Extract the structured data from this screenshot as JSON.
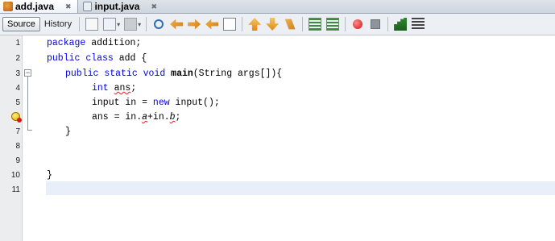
{
  "tabs": [
    {
      "label": "add.java",
      "close": "✖"
    },
    {
      "label": "input.java",
      "close": "✖"
    }
  ],
  "toolbar": {
    "source_label": "Source",
    "history_label": "History"
  },
  "editor": {
    "line_numbers": [
      "1",
      "2",
      "3",
      "4",
      "5",
      "6",
      "7",
      "8",
      "9",
      "10",
      "11"
    ],
    "lines": {
      "l1_kw": "package",
      "l1_rest": " addition;",
      "l2_kw1": "public",
      "l2_kw2": "class",
      "l2_rest": " add {",
      "l3_kw1": "public",
      "l3_kw2": "static",
      "l3_kw3": "void",
      "l3_name": "main",
      "l3_rest": "(String args[]){",
      "l4_kw": "int",
      "l4_var": "ans",
      "l4_rest": ";",
      "l5_pre": "input in = ",
      "l5_kw": "new",
      "l5_rest": " input();",
      "l6_pre": "ans = in.",
      "l6_a": "a",
      "l6_mid": "+in.",
      "l6_b": "b",
      "l6_end": ";",
      "l7": "}",
      "l10": "}"
    },
    "fold_glyph": "−"
  },
  "icons": [
    "history-icon",
    "back-icon",
    "forward-icon",
    "search-icon",
    "find-prev-icon",
    "find-next-icon",
    "toggle-highlight-icon",
    "toggle-bookmark-icon",
    "prev-bookmark-icon",
    "next-bookmark-icon",
    "shift-left-icon",
    "shift-right-icon",
    "record-macro-icon",
    "stop-macro-icon",
    "comment-icon",
    "uncomment-icon"
  ],
  "colors": {
    "keyword": "#0000e6",
    "error_squiggle": "#e02020",
    "current_line": "#e9effa"
  }
}
